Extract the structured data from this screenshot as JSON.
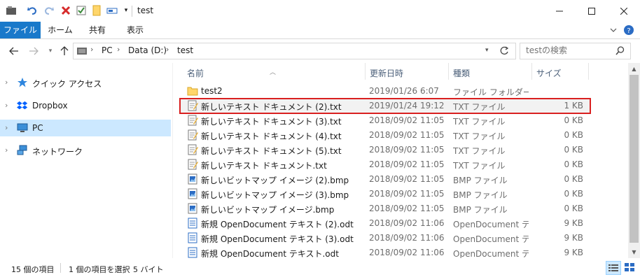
{
  "window": {
    "title": "test"
  },
  "ribbon": {
    "tabs": [
      "ファイル",
      "ホーム",
      "共有",
      "表示"
    ]
  },
  "address": {
    "crumbs": [
      "PC",
      "Data (D:)",
      "test"
    ]
  },
  "search": {
    "placeholder": "testの検索"
  },
  "navpane": {
    "items": [
      {
        "label": "クイック アクセス",
        "icon": "star-icon"
      },
      {
        "label": "Dropbox",
        "icon": "dropbox-icon"
      },
      {
        "label": "PC",
        "icon": "pc-icon",
        "selected": true
      },
      {
        "label": "ネットワーク",
        "icon": "network-icon"
      }
    ]
  },
  "columns": {
    "name": "名前",
    "date": "更新日時",
    "type": "種類",
    "size": "サイズ"
  },
  "files": [
    {
      "name": "test2",
      "date": "2019/01/26 6:07",
      "type": "ファイル フォルダー",
      "size": "",
      "icon": "folder-icon"
    },
    {
      "name": "新しいテキスト ドキュメント (2).txt",
      "date": "2019/01/24 19:12",
      "type": "TXT ファイル",
      "size": "1 KB",
      "icon": "txt-file-icon",
      "highlight": true
    },
    {
      "name": "新しいテキスト ドキュメント (3).txt",
      "date": "2018/09/02 11:05",
      "type": "TXT ファイル",
      "size": "0 KB",
      "icon": "txt-file-icon"
    },
    {
      "name": "新しいテキスト ドキュメント (4).txt",
      "date": "2018/09/02 11:05",
      "type": "TXT ファイル",
      "size": "0 KB",
      "icon": "txt-file-icon"
    },
    {
      "name": "新しいテキスト ドキュメント (5).txt",
      "date": "2018/09/02 11:05",
      "type": "TXT ファイル",
      "size": "0 KB",
      "icon": "txt-file-icon"
    },
    {
      "name": "新しいテキスト ドキュメント.txt",
      "date": "2018/09/02 11:05",
      "type": "TXT ファイル",
      "size": "0 KB",
      "icon": "txt-file-icon"
    },
    {
      "name": "新しいビットマップ イメージ (2).bmp",
      "date": "2018/09/02 11:05",
      "type": "BMP ファイル",
      "size": "0 KB",
      "icon": "bmp-file-icon"
    },
    {
      "name": "新しいビットマップ イメージ (3).bmp",
      "date": "2018/09/02 11:05",
      "type": "BMP ファイル",
      "size": "0 KB",
      "icon": "bmp-file-icon"
    },
    {
      "name": "新しいビットマップ イメージ.bmp",
      "date": "2018/09/02 11:05",
      "type": "BMP ファイル",
      "size": "0 KB",
      "icon": "bmp-file-icon"
    },
    {
      "name": "新規 OpenDocument テキスト (2).odt",
      "date": "2018/09/02 11:06",
      "type": "OpenDocument テ...",
      "size": "9 KB",
      "icon": "odt-file-icon"
    },
    {
      "name": "新規 OpenDocument テキスト (3).odt",
      "date": "2018/09/02 11:06",
      "type": "OpenDocument テ...",
      "size": "9 KB",
      "icon": "odt-file-icon"
    },
    {
      "name": "新規 OpenDocument テキスト.odt",
      "date": "2018/09/02 11:06",
      "type": "OpenDocument テ...",
      "size": "9 KB",
      "icon": "odt-file-icon"
    }
  ],
  "status": {
    "item_count": "15 個の項目",
    "selection": "1 個の項目を選択",
    "selection_size": "5 バイト"
  },
  "colors": {
    "accent": "#1979ca",
    "selection": "#cce8ff",
    "highlight_border": "#d92020"
  }
}
